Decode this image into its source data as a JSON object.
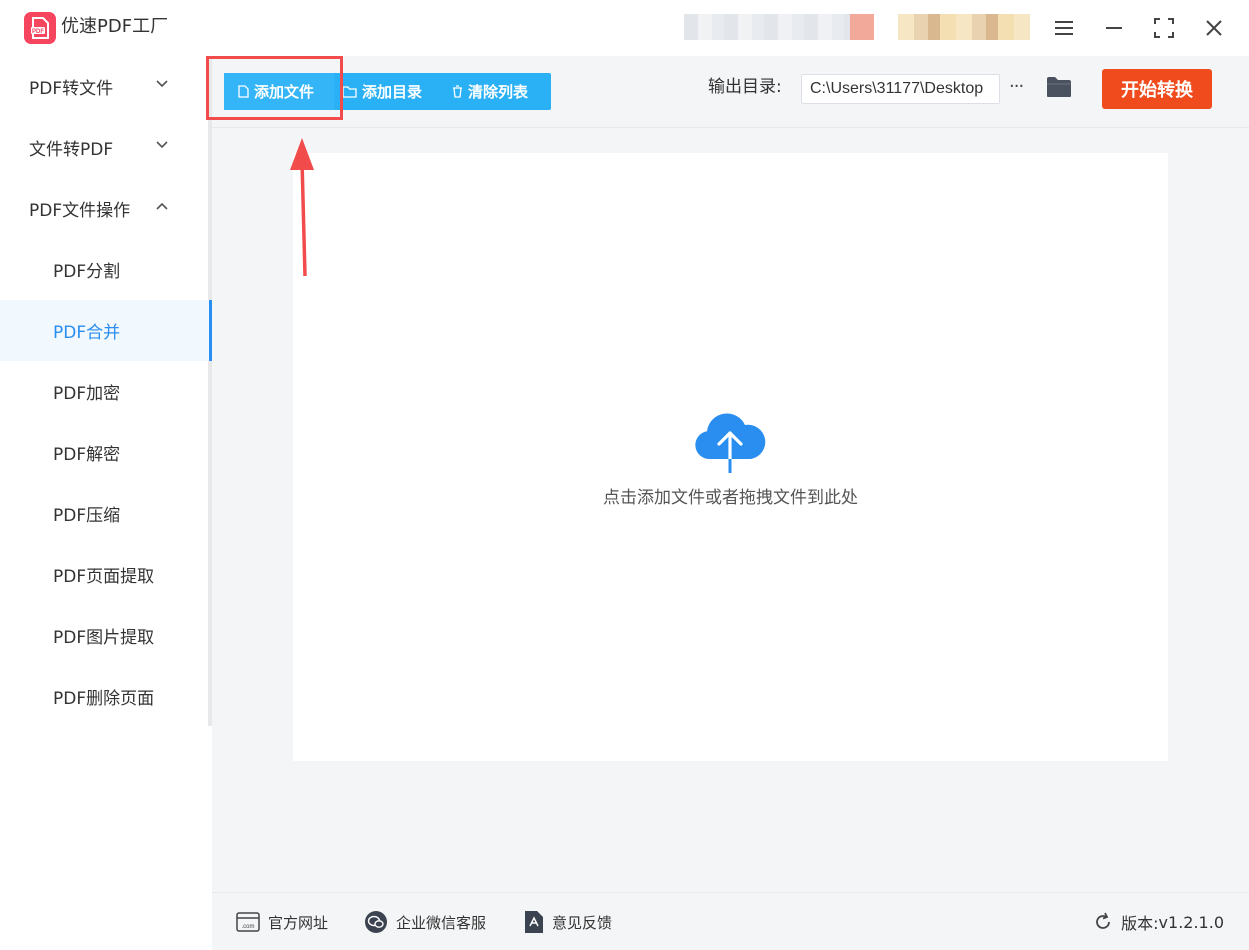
{
  "app": {
    "title": "优速PDF工厂",
    "logo_text": "PDF"
  },
  "window_controls": {
    "menu": "menu-icon",
    "minimize": "minimize-icon",
    "maximize": "maximize-icon",
    "close": "close-icon"
  },
  "sidebar": {
    "categories": [
      {
        "label": "PDF转文件",
        "expanded": false
      },
      {
        "label": "文件转PDF",
        "expanded": false
      },
      {
        "label": "PDF文件操作",
        "expanded": true
      }
    ],
    "subitems": [
      {
        "label": "PDF分割",
        "active": false
      },
      {
        "label": "PDF合并",
        "active": true
      },
      {
        "label": "PDF加密",
        "active": false
      },
      {
        "label": "PDF解密",
        "active": false
      },
      {
        "label": "PDF压缩",
        "active": false
      },
      {
        "label": "PDF页面提取",
        "active": false
      },
      {
        "label": "PDF图片提取",
        "active": false
      },
      {
        "label": "PDF删除页面",
        "active": false
      }
    ]
  },
  "toolbar": {
    "add_file": "添加文件",
    "add_dir": "添加目录",
    "clear_list": "清除列表",
    "output_label": "输出目录:",
    "output_path": "C:\\Users\\31177\\Desktop",
    "more": "···",
    "start": "开始转换"
  },
  "dropzone": {
    "hint": "点击添加文件或者拖拽文件到此处"
  },
  "footer": {
    "website": "官方网址",
    "wechat_service": "企业微信客服",
    "feedback": "意见反馈",
    "version_label": "版本:",
    "version_value": "v1.2.1.0"
  },
  "colors": {
    "accent_blue": "#2ab0f5",
    "active_blue": "#2a8ef0",
    "start_red": "#f04b1c",
    "highlight_red": "#f24b4b",
    "logo_pink": "#f5455f"
  }
}
